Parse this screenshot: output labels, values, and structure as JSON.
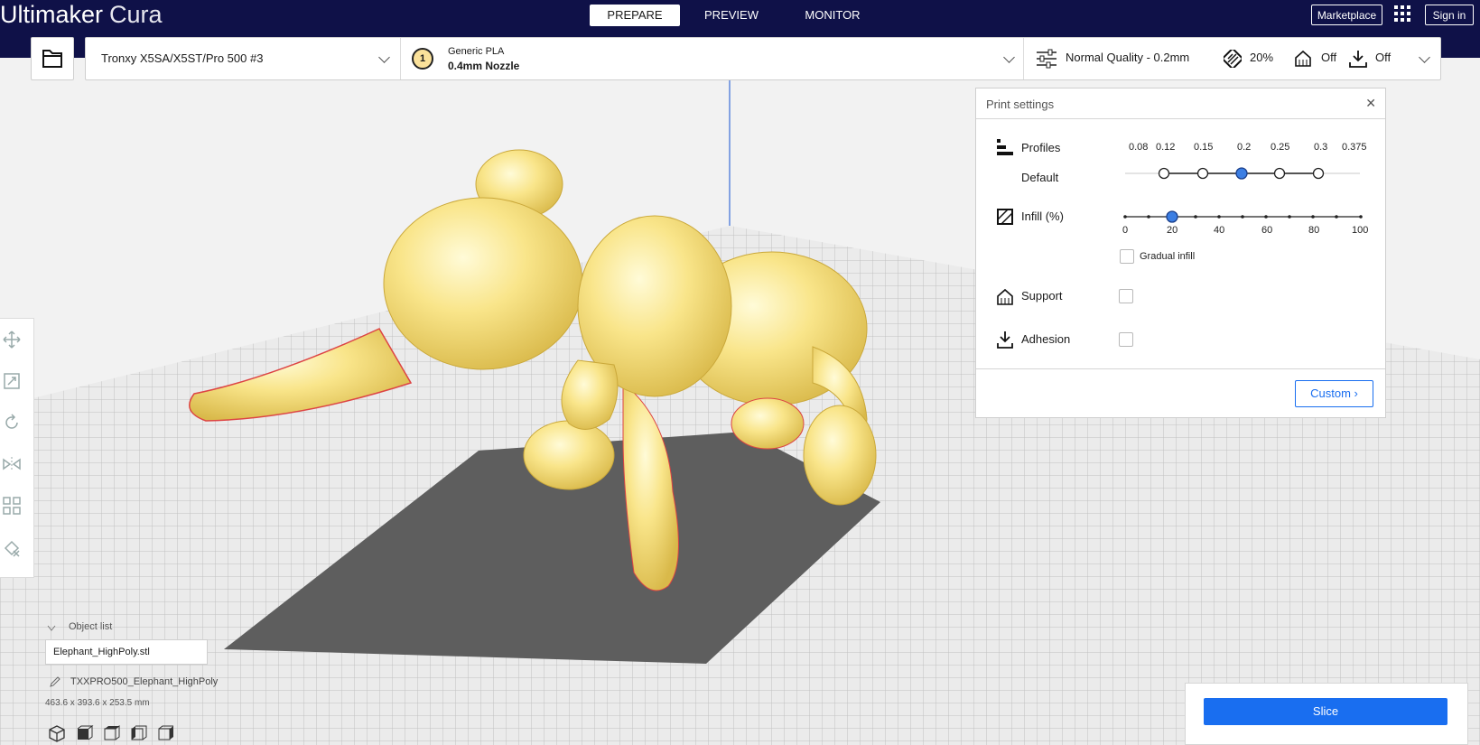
{
  "app": {
    "brand": "Ultimaker",
    "product": "Cura"
  },
  "stages": [
    {
      "label": "PREPARE",
      "active": true
    },
    {
      "label": "PREVIEW",
      "active": false
    },
    {
      "label": "MONITOR",
      "active": false
    }
  ],
  "top_right": {
    "marketplace": "Marketplace",
    "sign_in": "Sign in"
  },
  "printer": {
    "name": "Tronxy X5SA/X5ST/Pro 500 #3"
  },
  "extruder": {
    "number": "1",
    "material": "Generic PLA",
    "nozzle": "0.4mm Nozzle"
  },
  "summary": {
    "quality": "Normal Quality - 0.2mm",
    "infill": "20%",
    "support": "Off",
    "adhesion": "Off"
  },
  "print_settings": {
    "title": "Print settings",
    "profiles_label": "Profiles",
    "profile_default": "Default",
    "layer_heights": [
      "0.08",
      "0.12",
      "0.15",
      "0.2",
      "0.25",
      "0.3",
      "0.375"
    ],
    "selected_layer_height": "0.2",
    "infill_label": "Infill (%)",
    "infill_ticks": [
      "0",
      "20",
      "40",
      "60",
      "80",
      "100"
    ],
    "infill_value": 20,
    "gradual_infill_label": "Gradual infill",
    "support_label": "Support",
    "adhesion_label": "Adhesion",
    "custom_label": "Custom"
  },
  "object_list": {
    "label": "Object list",
    "file": "Elephant_HighPoly.stl",
    "job_name": "TXXPRO500_Elephant_HighPoly",
    "dimensions": "463.6 x 393.6 x 253.5 mm"
  },
  "slice": {
    "label": "Slice"
  },
  "colors": {
    "header": "#0f1148",
    "accent": "#196ef0",
    "model": "#f6e27a",
    "build_plate": "#e9e9e9"
  }
}
